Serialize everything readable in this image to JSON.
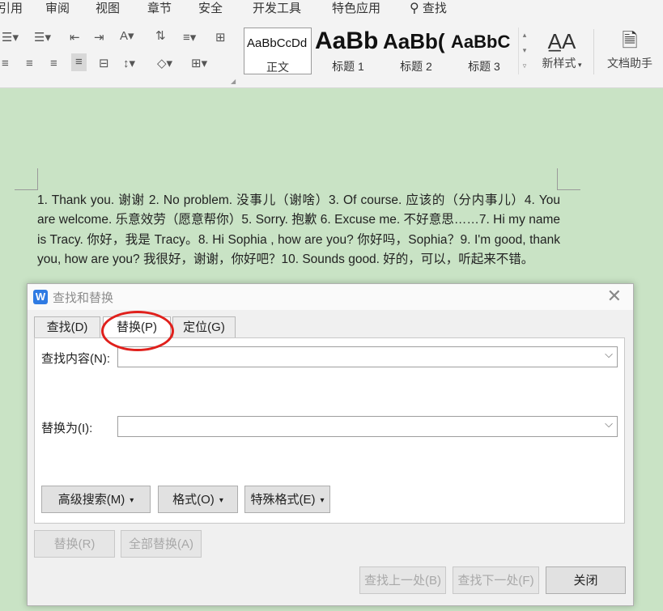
{
  "menu": {
    "items": [
      "引用",
      "审阅",
      "视图",
      "章节",
      "安全",
      "开发工具",
      "特色应用"
    ],
    "search_label": "查找"
  },
  "styles": {
    "samples": [
      {
        "sample": "AaBbCcDd",
        "label": "正文"
      },
      {
        "sample": "AaBb",
        "label": "标题 1"
      },
      {
        "sample": "AaBb(",
        "label": "标题 2"
      },
      {
        "sample": "AaBbC",
        "label": "标题 3"
      }
    ],
    "new_style_label": "新样式",
    "assistant_label": "文档助手"
  },
  "document": {
    "text": "1.  Thank you. 谢谢 2.  No problem. 没事儿（谢啥）3.  Of course. 应该的（分内事儿）4.  You are welcome. 乐意效劳（愿意帮你）5.  Sorry. 抱歉 6.  Excuse me. 不好意思……7.  Hi my name is Tracy. 你好，我是 Tracy。8.  Hi Sophia , how are you? 你好吗，Sophia？9.  I'm good, thank you, how are you? 我很好，谢谢，你好吧？10.  Sounds good. 好的，可以，听起来不错。"
  },
  "dialog": {
    "title": "查找和替换",
    "logo": "W",
    "tabs": [
      "查找(D)",
      "替换(P)",
      "定位(G)"
    ],
    "find_label": "查找内容(N):",
    "find_value": "",
    "replace_label": "替换为(I):",
    "replace_value": "",
    "advanced_label": "高级搜索(M)",
    "format_label": "格式(O)",
    "special_label": "特殊格式(E)",
    "replace_btn": "替换(R)",
    "replace_all_btn": "全部替换(A)",
    "find_prev_btn": "查找上一处(B)",
    "find_next_btn": "查找下一处(F)",
    "close_btn": "关闭"
  },
  "colors": {
    "doc_background": "#c9e3c5",
    "annotation_circle": "#e0201c",
    "wps_blue": "#2f7be3"
  }
}
